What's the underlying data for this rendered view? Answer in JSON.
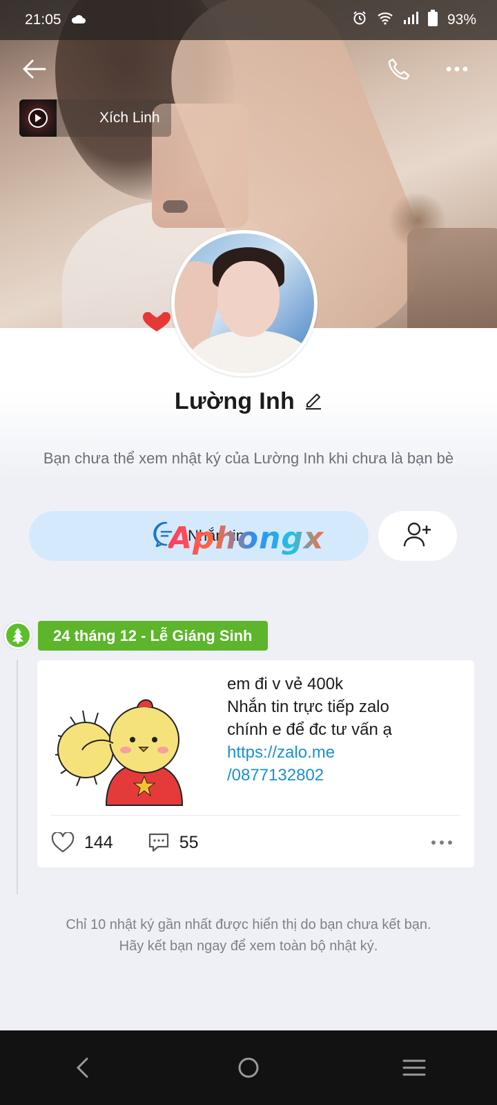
{
  "status_bar": {
    "time": "21:05",
    "battery": "93%",
    "icons": [
      "cloud-icon",
      "alarm-icon",
      "wifi-icon",
      "signal-icon",
      "battery-icon"
    ]
  },
  "header": {
    "icons": [
      "back-arrow-icon",
      "phone-icon",
      "more-icon"
    ]
  },
  "music": {
    "title": "Xích Linh"
  },
  "profile": {
    "name": "Lường Inh",
    "notice": "Bạn chưa thể xem nhật ký của Lường Inh khi chưa là bạn bè"
  },
  "buttons": {
    "message_label": "Nhắn tin",
    "watermark": "Aphongx"
  },
  "timeline": {
    "date_label": "24 tháng 12 - Lễ Giáng Sinh",
    "post": {
      "line1": "em đi v vẻ 400k",
      "line2": "Nhắn tin trực tiếp zalo",
      "line3": "chính e để đc tư vấn ạ",
      "link_line1": "https://zalo.me",
      "link_line2": "/0877132802",
      "likes": "144",
      "comments": "55"
    },
    "footer_line1": "Chỉ 10 nhật ký gần nhất được hiển thị do bạn chưa kết bạn.",
    "footer_line2": "Hãy kết bạn ngay để xem toàn bộ nhật ký."
  },
  "colors": {
    "accent_green": "#5cb52a",
    "link_blue": "#1890d6",
    "message_button_bg": "#d5e9fc"
  }
}
